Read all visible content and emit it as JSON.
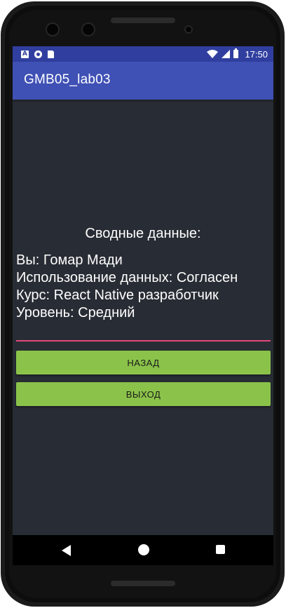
{
  "statusbar": {
    "left_icons": [
      "a-notification-icon",
      "circle-notification-icon",
      "sd-card-icon"
    ],
    "right_icons": [
      "wifi-icon",
      "signal-icon",
      "battery-icon"
    ],
    "time": "17:50"
  },
  "toolbar": {
    "title": "GMB05_lab03"
  },
  "summary": {
    "title": "Сводные данные:",
    "lines": [
      "Вы: Гомар Мади",
      "Использование данных: Согласен",
      "Курс: React Native разработчик",
      "Уровень: Средний"
    ]
  },
  "buttons": {
    "back_label": "НАЗАД",
    "exit_label": "ВЫХОД"
  },
  "navbar": {
    "icons": [
      "back-icon",
      "home-icon",
      "recents-icon"
    ]
  },
  "colors": {
    "statusbar": "#303f9f",
    "toolbar": "#3f51b5",
    "background": "#282c34",
    "divider": "#e5487d",
    "button": "#8bc34a"
  }
}
